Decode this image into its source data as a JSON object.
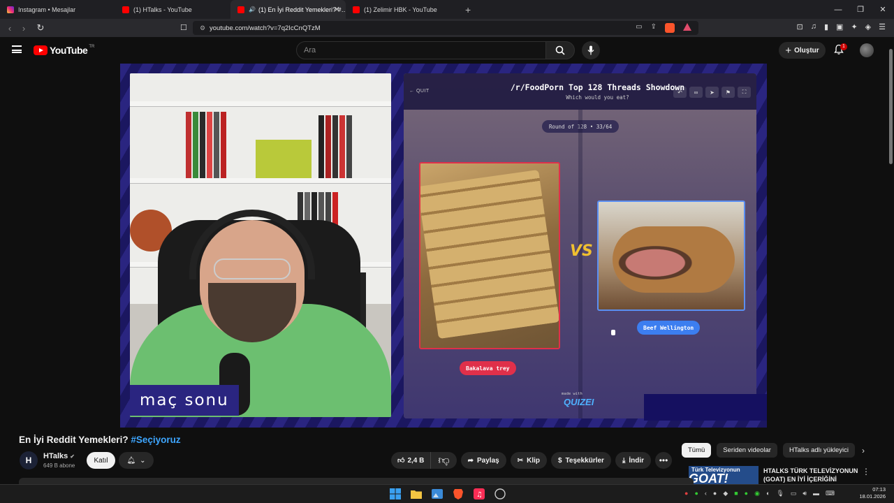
{
  "browser": {
    "tabs": [
      {
        "label": "Instagram • Mesajlar",
        "favicon": "instagram-icon",
        "active": false
      },
      {
        "label": "(1) HTalks - YouTube",
        "favicon": "youtube-icon",
        "active": false
      },
      {
        "label": "(1) En İyi Reddit Yemekleri? #…",
        "favicon": "youtube-icon",
        "active": true,
        "audio": true
      },
      {
        "label": "(1) Zelimir HBK - YouTube",
        "favicon": "youtube-icon",
        "active": false
      }
    ],
    "new_tab": "+",
    "url": "youtube.com/watch?v=7q2IcCnQTzM",
    "window_controls": {
      "minimize": "—",
      "restore": "❐",
      "close": "✕"
    }
  },
  "youtube": {
    "logo_text": "YouTube",
    "region": "TR",
    "search_placeholder": "Ara",
    "create_label": "Oluştur",
    "notification_count": "1"
  },
  "video_overlay": {
    "caption": "maç sonu",
    "quit": "QUIT",
    "game_title": "/r/FoodPorn Top 128 Threads Showdown",
    "game_subtitle": "Which would you eat?",
    "round": "Round of 128 • 33/64",
    "vs": "VS",
    "left_option": "Bakalava trey",
    "right_option": "Beef Wellington",
    "made_with": "made with",
    "brand": "QUIZEI"
  },
  "video": {
    "title": "En İyi Reddit Yemekleri?",
    "hashtag": "#Seçiyoruz",
    "channel": "HTalks",
    "channel_initials": "H",
    "subscribers": "649 B abone",
    "join_label": "Katıl",
    "likes": "2,4 B",
    "share_label": "Paylaş",
    "clip_label": "Klip",
    "thanks_label": "Teşekkürler",
    "download_label": "İndir",
    "more": "•••"
  },
  "sidebar": {
    "chips": [
      "Tümü",
      "Seriden videolar",
      "HTalks adlı yükleyici"
    ],
    "recommendation": {
      "thumb_text": "Türk Televizyonun",
      "thumb_big": "GOAT!",
      "title": "HTALKS TÜRK TELEVİZYONUN (GOAT) EN İYİ İÇERİĞİNİ"
    }
  },
  "taskbar": {
    "time": "07:13",
    "date": "18.01.2026"
  },
  "colors": {
    "accent_red": "#ff0000",
    "link_blue": "#3ea6ff",
    "pill_red": "#e0304a",
    "pill_blue": "#3c7ef0"
  }
}
